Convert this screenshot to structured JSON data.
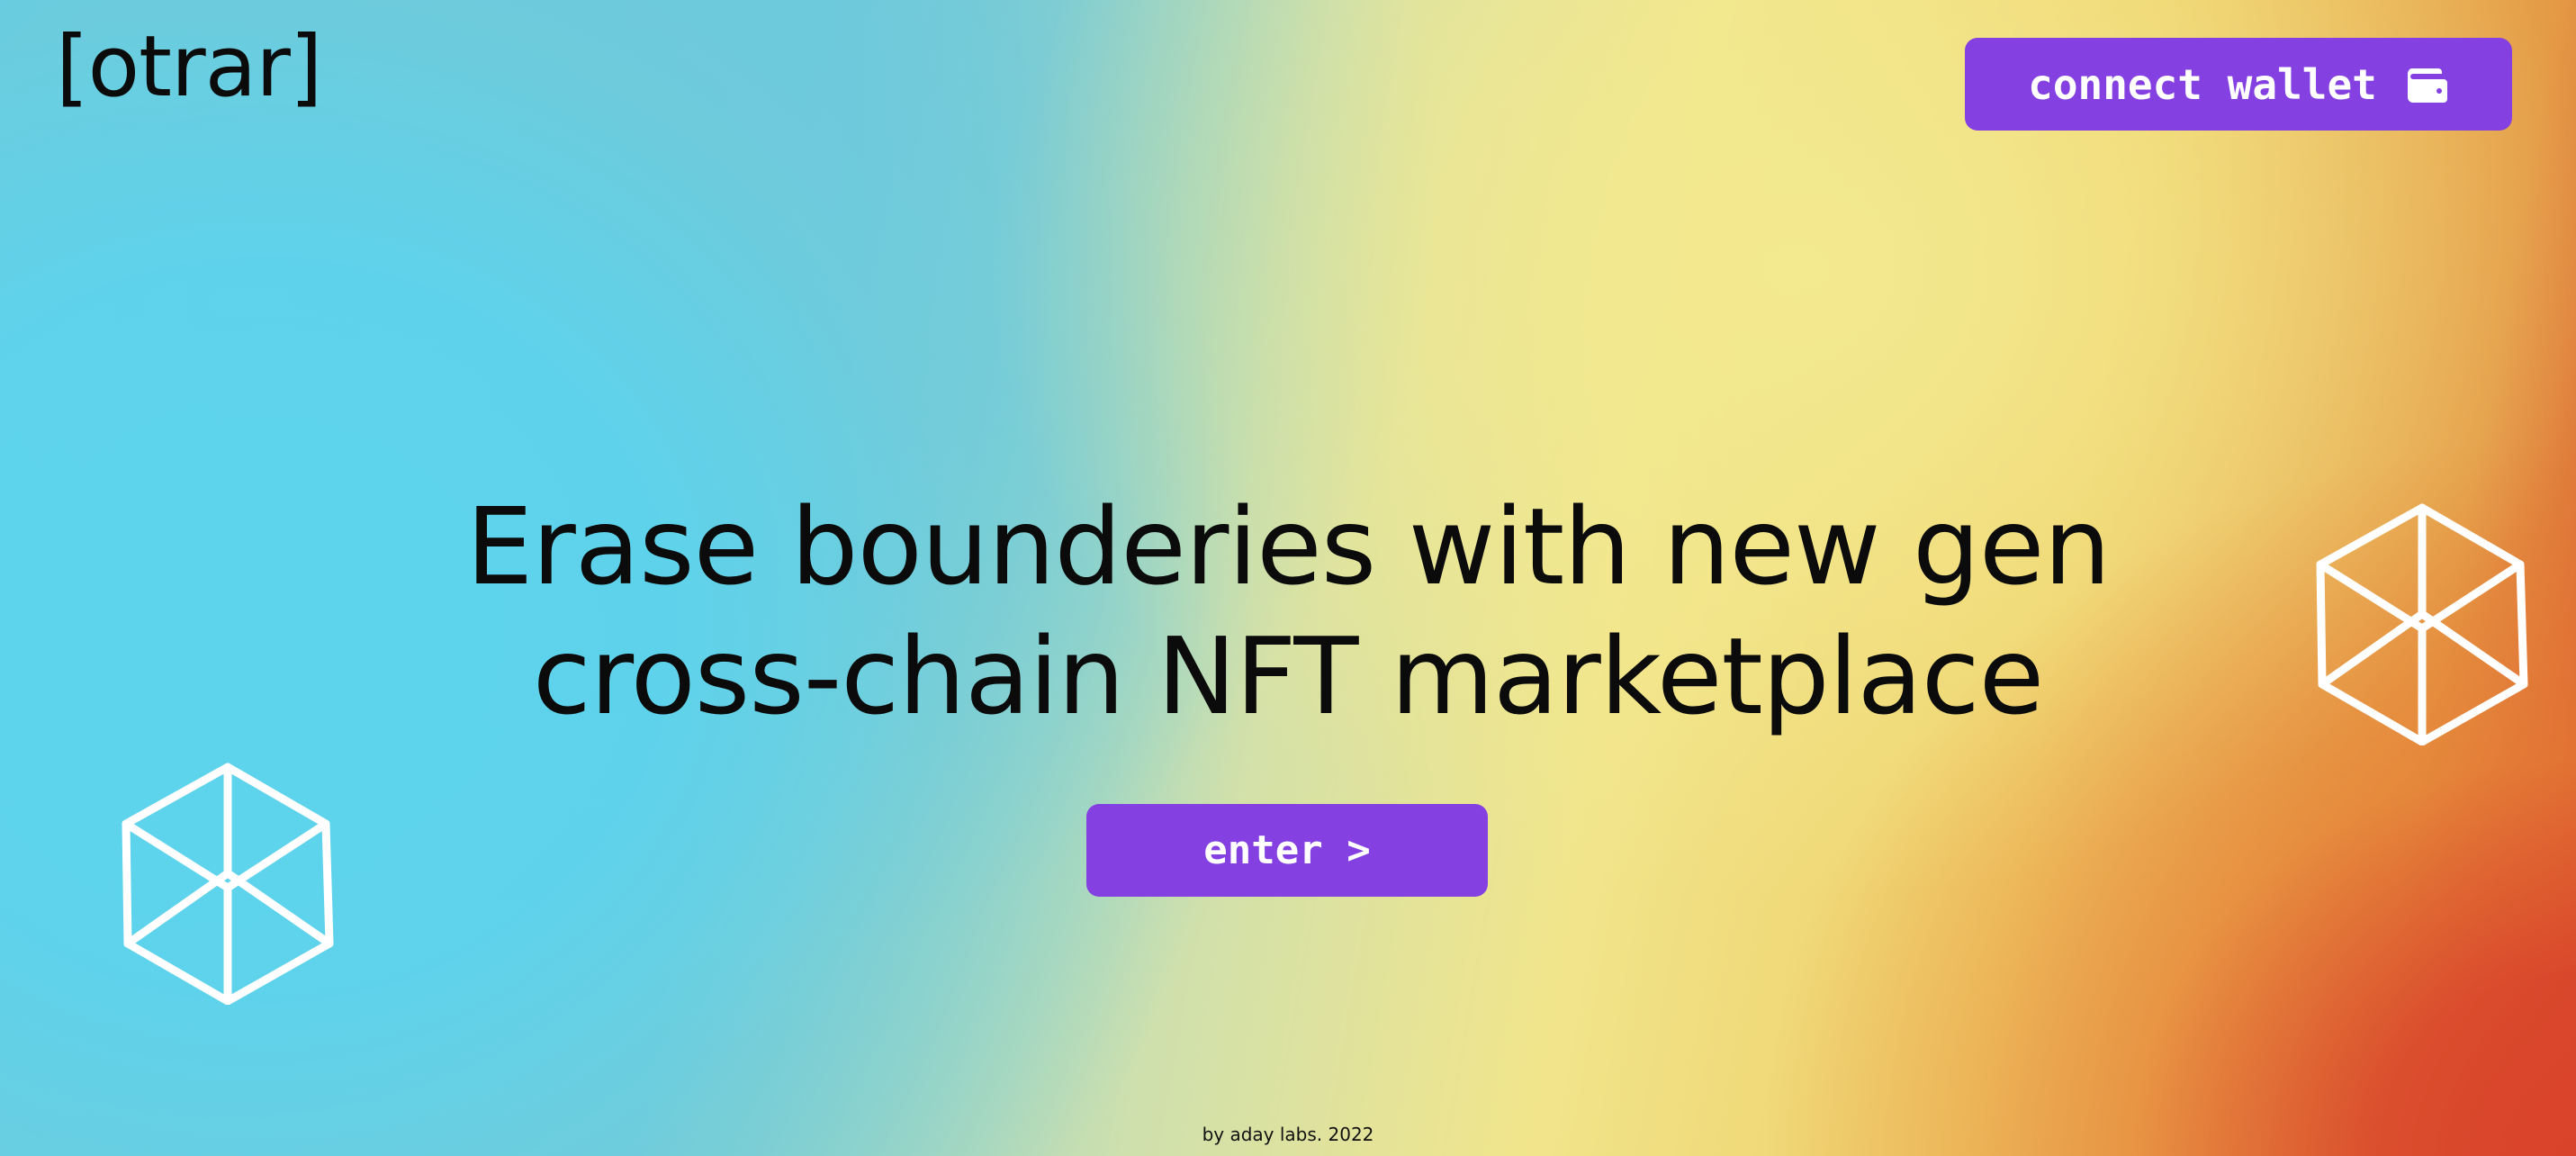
{
  "brand": {
    "logo_text": "[otrar]"
  },
  "header": {
    "connect_label": "connect wallet",
    "connect_icon": "wallet-icon"
  },
  "hero": {
    "headline_line1": "Erase bounderies with new gen",
    "headline_line2": "cross-chain NFT marketplace",
    "enter_label": "enter >"
  },
  "decor": {
    "icon": "cube-wireframe-icon"
  },
  "footer": {
    "text": "by aday labs. 2022"
  },
  "colors": {
    "accent": "#8540e2",
    "text": "#0b0b0b",
    "button_text": "#ffffff"
  }
}
